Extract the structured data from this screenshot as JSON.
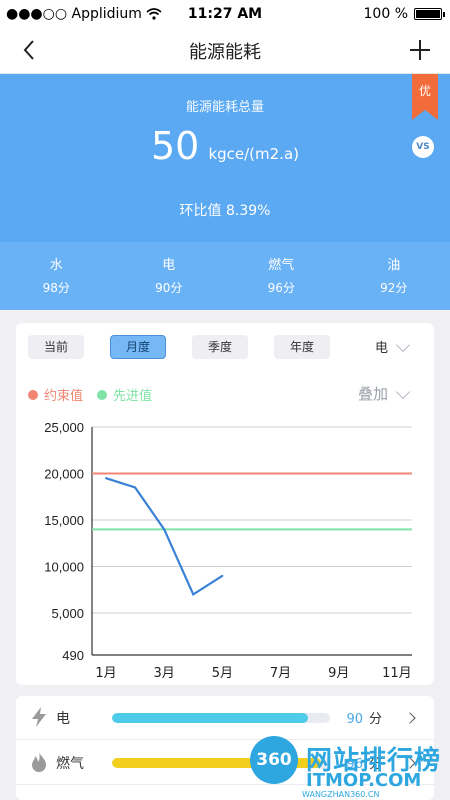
{
  "status_bar": {
    "carrier": "●●●○○ Applidium",
    "time": "11:27 AM",
    "battery": "100 %",
    "battery_level": 1.0
  },
  "nav": {
    "title": "能源能耗"
  },
  "hero": {
    "label": "能源能耗总量",
    "value": "50",
    "unit": "kgce/(m2.a)",
    "ratio": "环比值 8.39%",
    "badge": "优",
    "vs": "VS"
  },
  "scores": [
    {
      "name": "水",
      "value": "98分"
    },
    {
      "name": "电",
      "value": "90分"
    },
    {
      "name": "燃气",
      "value": "96分"
    },
    {
      "name": "油",
      "value": "92分"
    }
  ],
  "period_tabs": [
    "当前",
    "月度",
    "季度",
    "年度"
  ],
  "active_tab": 1,
  "energy_select": "电",
  "legend": {
    "limit": "约束值",
    "advanced": "先进值",
    "mode": "叠加"
  },
  "colors": {
    "primary": "#5ba9f3",
    "limit": "#f08573",
    "advanced": "#7fe3a6",
    "line": "#3a82d6",
    "elec_bar": "#4ecbe8",
    "gas_bar": "#f2cf1c"
  },
  "chart_data": {
    "type": "line",
    "x_ticks": [
      "1月",
      "3月",
      "5月",
      "7月",
      "9月",
      "11月"
    ],
    "y_ticks": [
      "25,000",
      "20,000",
      "15,000",
      "10,000",
      "5,000",
      "490"
    ],
    "ylim": [
      490,
      25000
    ],
    "xlim": [
      1,
      12
    ],
    "series": [
      {
        "x": [
          1,
          2,
          3,
          4,
          5
        ],
        "values": [
          19500,
          18500,
          14000,
          7000,
          9000
        ]
      }
    ],
    "limit_value": 20000,
    "advanced_value": 14000,
    "grid": true
  },
  "list": [
    {
      "name": "电",
      "score": "90",
      "unit": "分",
      "fraction": 0.9
    },
    {
      "name": "燃气",
      "score": "96",
      "unit": "分",
      "fraction": 0.96
    }
  ],
  "watermark": {
    "logo": "360",
    "title": "网站排行榜",
    "domain": "ITMOP.COM",
    "sub": "WANGZHAN360.CN"
  }
}
